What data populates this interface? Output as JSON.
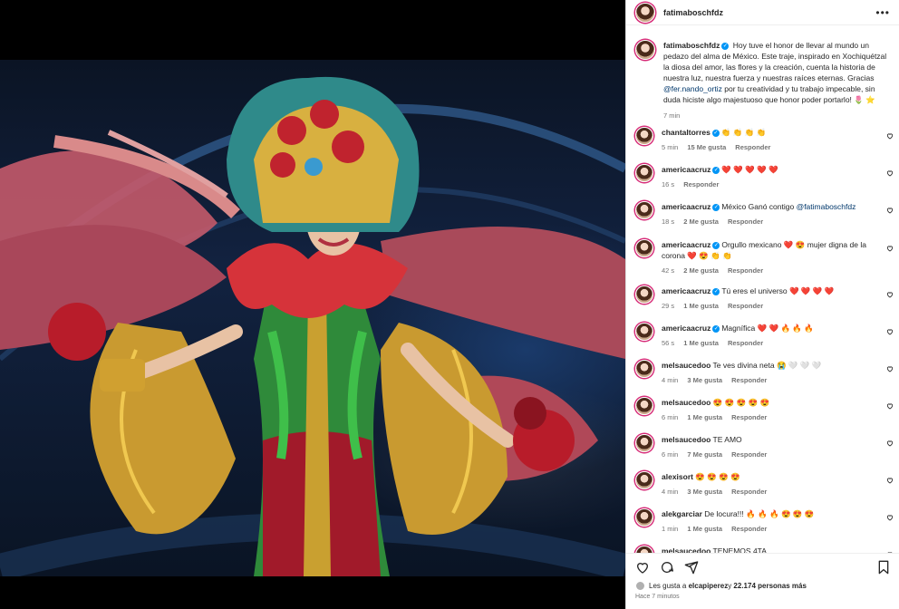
{
  "post": {
    "username": "fatimaboschfdz",
    "caption_segments": [
      "Hoy tuve el honor de llevar al mundo un pedazo del alma de México. Este traje, inspirado en Xochiquétzal la diosa del amor, las flores y la creación, cuenta la historia de nuestra luz, nuestra fuerza y nuestras raíces eternas. Gracias ",
      "@fer.nando_ortiz",
      " por tu creatividad y tu trabajo impecable, sin duda hiciste algo majestuoso que honor poder portarlo! 🌷 ⭐"
    ],
    "caption_time": "7 min",
    "carousel_total": 7,
    "carousel_active": 6
  },
  "labels": {
    "reply": "Responder",
    "more": "•••"
  },
  "comments": [
    {
      "user": "chantaltorres",
      "verified": true,
      "text": "👏 👏 👏 👏",
      "time": "5 min",
      "likes": "15 Me gusta"
    },
    {
      "user": "americaacruz",
      "verified": true,
      "text": "❤️ ❤️ ❤️ ❤️ ❤️",
      "time": "16 s",
      "likes": ""
    },
    {
      "user": "americaacruz",
      "verified": true,
      "text": "México Ganó contigo ",
      "mention": "@fatimaboschfdz",
      "time": "18 s",
      "likes": "2 Me gusta"
    },
    {
      "user": "americaacruz",
      "verified": true,
      "text": "Orgullo mexicano ❤️ 😍 mujer digna de la corona ❤️ 😍 👏 👏",
      "time": "42 s",
      "likes": "2 Me gusta"
    },
    {
      "user": "americaacruz",
      "verified": true,
      "text": "Tú eres el universo ❤️ ❤️ ❤️ ❤️",
      "time": "29 s",
      "likes": "1 Me gusta"
    },
    {
      "user": "americaacruz",
      "verified": true,
      "text": "Magnífica ❤️ ❤️ 🔥 🔥 🔥",
      "time": "56 s",
      "likes": "1 Me gusta"
    },
    {
      "user": "melsaucedoo",
      "verified": false,
      "text": "Te ves divina neta 😭 🤍 🤍 🤍",
      "time": "4 min",
      "likes": "3 Me gusta"
    },
    {
      "user": "melsaucedoo",
      "verified": false,
      "text": "😍 😍 😍 😍 😍",
      "time": "6 min",
      "likes": "1 Me gusta"
    },
    {
      "user": "melsaucedoo",
      "verified": false,
      "text": "TE AMO",
      "time": "6 min",
      "likes": "7 Me gusta"
    },
    {
      "user": "alexisort",
      "verified": false,
      "text": "😍 😍 😍 😍",
      "time": "4 min",
      "likes": "3 Me gusta"
    },
    {
      "user": "alekgarciar",
      "verified": false,
      "text": "De locura!!! 🔥 🔥 🔥 😍 😍 😍",
      "time": "1 min",
      "likes": "1 Me gusta"
    },
    {
      "user": "melsaucedoo",
      "verified": false,
      "text": "TENEMOS 4TA",
      "time": "",
      "likes": ""
    }
  ],
  "footer": {
    "likes_prefix": "Les gusta a ",
    "likes_user": "elcapiperez",
    "likes_mid": " y ",
    "likes_count": "22.174 personas más",
    "time_ago": "Hace 7 minutos"
  },
  "colors": {
    "verified": "#0095f6",
    "link": "#00376b",
    "muted": "#737373",
    "ring": "#d62976"
  }
}
